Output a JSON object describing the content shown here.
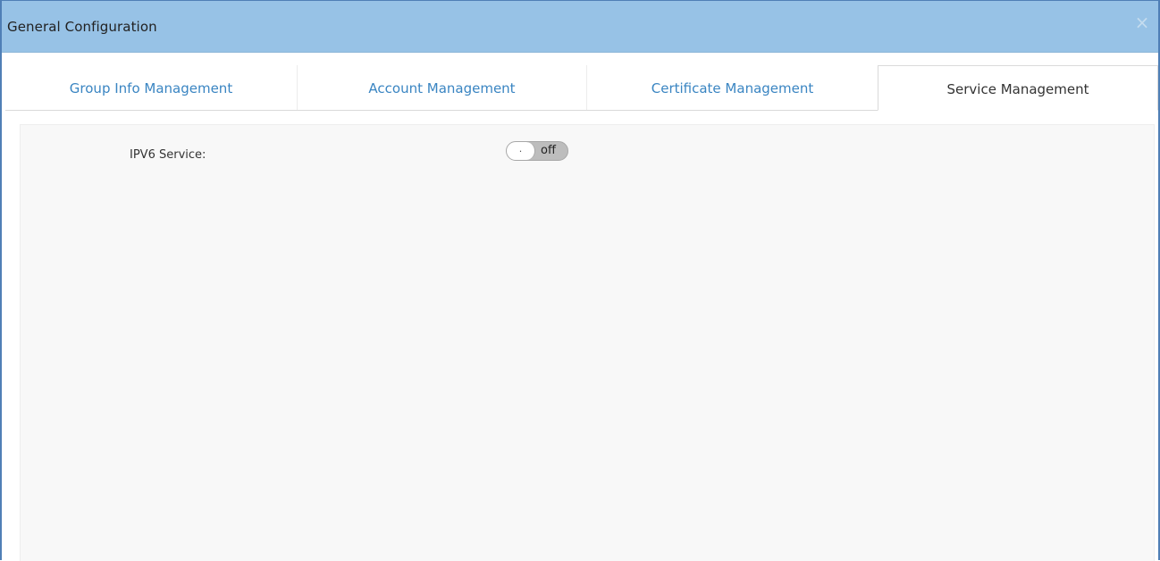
{
  "dialog": {
    "title": "General Configuration",
    "close_glyph": "×"
  },
  "tabs": [
    {
      "label": "Group Info Management",
      "active": false
    },
    {
      "label": "Account Management",
      "active": false
    },
    {
      "label": "Certificate Management",
      "active": false
    },
    {
      "label": "Service Management",
      "active": true
    }
  ],
  "service": {
    "ipv6_label": "IPV6 Service:",
    "ipv6_toggle_knob": ".",
    "ipv6_toggle_state": "off"
  },
  "colors": {
    "header_bg": "#97c2e6",
    "tab_link": "#3a85c2",
    "border_accent": "#4f7fb6"
  },
  "icons": {
    "close": "close-icon"
  }
}
